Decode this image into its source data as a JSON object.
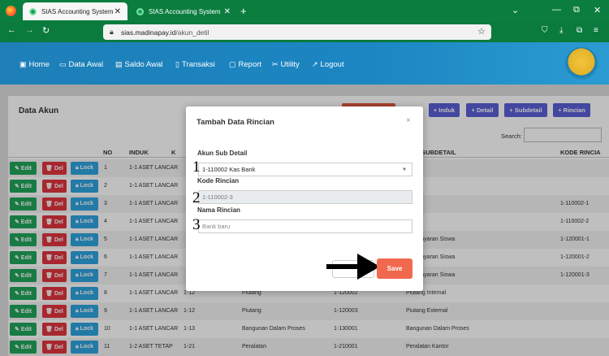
{
  "browser": {
    "tabs": [
      {
        "title": "SIAS Accounting System",
        "active": true
      },
      {
        "title": "SIAS Accounting System",
        "active": false
      }
    ],
    "url_domain": "sias.madinapay.id",
    "url_path": "/akun_detil"
  },
  "app": {
    "menu": [
      {
        "icon": "save-icon",
        "label": "Home"
      },
      {
        "icon": "monitor-icon",
        "label": "Data Awal"
      },
      {
        "icon": "chart-icon",
        "label": "Saldo Awal"
      },
      {
        "icon": "page-icon",
        "label": "Transaksi"
      },
      {
        "icon": "window-icon",
        "label": "Report"
      },
      {
        "icon": "tools-icon",
        "label": "Utility"
      },
      {
        "icon": "logout-icon",
        "label": "Logout"
      }
    ]
  },
  "page": {
    "title": "Data Akun",
    "toolbar": [
      "+ Induk",
      "+ Detail",
      "+ Subdetail",
      "+ Rincian"
    ],
    "search_label": "Search:",
    "columns": [
      "NO",
      "INDUK",
      "K",
      "A SUBDETAIL",
      "KODE RINCIA"
    ],
    "row_buttons": {
      "edit": "Edit",
      "del": "Del",
      "lock": "Lock"
    },
    "rows": [
      {
        "no": "1",
        "induk": "1-1 ASET LANCAR",
        "c3": "",
        "c4": "",
        "subdetail": "angan",
        "rincian": ""
      },
      {
        "no": "2",
        "induk": "1-1 ASET LANCAR",
        "c3": "",
        "c4": "",
        "subdetail": "ank",
        "rincian": ""
      },
      {
        "no": "3",
        "induk": "1-1 ASET LANCAR",
        "c3": "",
        "c4": "",
        "subdetail": "ank",
        "rincian": "1-110002-1"
      },
      {
        "no": "4",
        "induk": "1-1 ASET LANCAR",
        "c3": "",
        "c4": "",
        "subdetail": "ank",
        "rincian": "1-110002-2"
      },
      {
        "no": "5",
        "induk": "1-1 ASET LANCAR",
        "c3": "",
        "c4": "",
        "subdetail": "Pembayaran Siswa",
        "rincian": "1-120001-1"
      },
      {
        "no": "6",
        "induk": "1-1 ASET LANCAR",
        "c3": "",
        "c4": "",
        "subdetail": "Pembayaran Siswa",
        "rincian": "1-120001-2"
      },
      {
        "no": "7",
        "induk": "1-1 ASET LANCAR",
        "c3": "",
        "c4": "",
        "subdetail": "Pembayaran Siswa",
        "rincian": "1-120001-3"
      },
      {
        "no": "8",
        "induk": "1-1 ASET LANCAR",
        "c3": "1-12",
        "c4": "Piutang",
        "c5": "1-120002",
        "subdetail": "Piutang Internal",
        "rincian": ""
      },
      {
        "no": "9",
        "induk": "1-1 ASET LANCAR",
        "c3": "1-12",
        "c4": "Piutang",
        "c5": "1-120003",
        "subdetail": "Piutang External",
        "rincian": ""
      },
      {
        "no": "10",
        "induk": "1-1 ASET LANCAR",
        "c3": "1-13",
        "c4": "Bangunan Dalam Proses",
        "c5": "1-130001",
        "subdetail": "Bangunan Dalam Proses",
        "rincian": ""
      },
      {
        "no": "11",
        "induk": "1-2 ASET TETAP",
        "c3": "1-21",
        "c4": "Peralatan",
        "c5": "1-210001",
        "subdetail": "Peralatan Kantor",
        "rincian": ""
      }
    ]
  },
  "modal": {
    "title": "Tambah Data Rincian",
    "close": "×",
    "fields": [
      {
        "label": "Akun Sub Detail",
        "value": "1-110002 Kas Bank",
        "step": "1"
      },
      {
        "label": "Kode Rincian",
        "value": "1-110002-3",
        "step": "2"
      },
      {
        "label": "Nama Rincian",
        "value": "Bank baru",
        "step": "3"
      }
    ],
    "save_label": "Save"
  }
}
